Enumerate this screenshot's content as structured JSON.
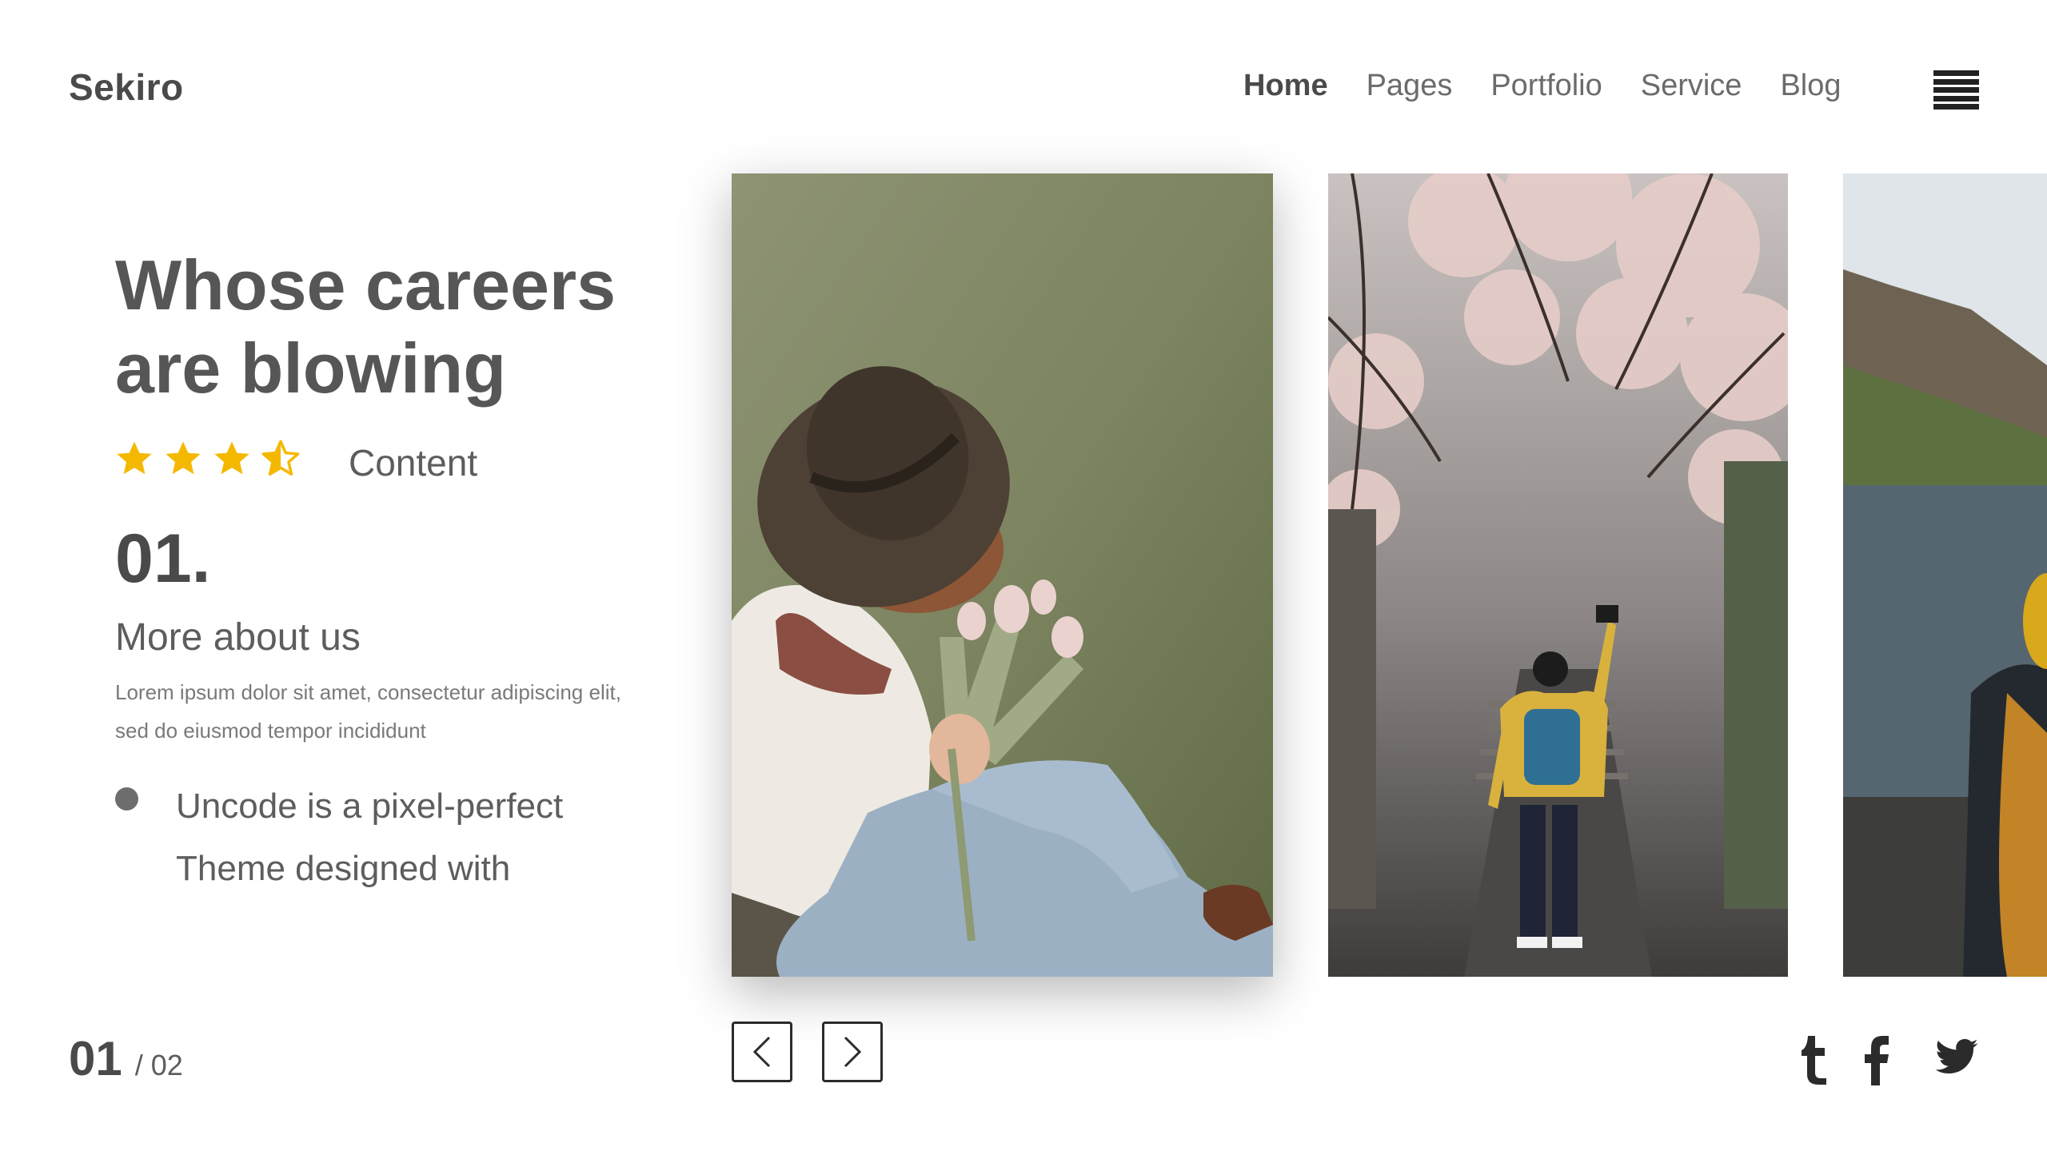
{
  "brand": {
    "logo": "Sekiro"
  },
  "nav": {
    "items": [
      {
        "label": "Home",
        "active": true
      },
      {
        "label": "Pages",
        "active": false
      },
      {
        "label": "Portfolio",
        "active": false
      },
      {
        "label": "Service",
        "active": false
      },
      {
        "label": "Blog",
        "active": false
      }
    ],
    "menu_icon": "hamburger-icon"
  },
  "hero": {
    "headline_line1": "Whose careers",
    "headline_line2": "are blowing",
    "rating": {
      "value": 3.5,
      "max": 4,
      "label": "Content",
      "color": "#f5b800"
    },
    "section_number": "01.",
    "section_title": "More about us",
    "section_text": "Lorem ipsum dolor sit amet, consectetur adipiscing elit, sed do eiusmod tempor incididunt",
    "bullet_line1": "Uncode is a pixel-perfect",
    "bullet_line2": "Theme designed with"
  },
  "gallery": {
    "photos": [
      {
        "name": "woman-with-hat-and-tulips-photo"
      },
      {
        "name": "man-photographing-cherry-blossoms-photo"
      },
      {
        "name": "hiker-by-lake-photo"
      }
    ],
    "prev_icon": "chevron-left-icon",
    "next_icon": "chevron-right-icon"
  },
  "pagination": {
    "current": "01",
    "total": "/ 02"
  },
  "social": [
    {
      "icon": "tumblr-icon"
    },
    {
      "icon": "facebook-icon"
    },
    {
      "icon": "twitter-icon"
    }
  ]
}
